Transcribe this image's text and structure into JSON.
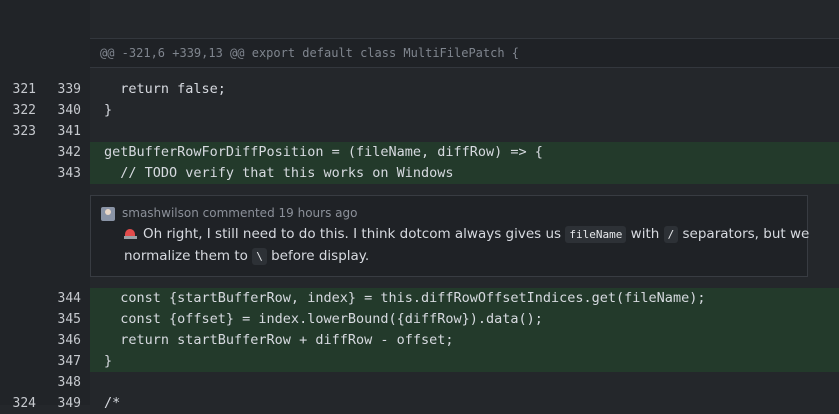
{
  "hunk_header": "@@ -321,6 +339,13 @@ export default class MultiFilePatch {",
  "lines_before": [
    {
      "old": "321",
      "new": "339",
      "code": "  return false;",
      "added": false
    },
    {
      "old": "322",
      "new": "340",
      "code": "}",
      "added": false
    },
    {
      "old": "323",
      "new": "341",
      "code": "",
      "added": false
    },
    {
      "old": "",
      "new": "342",
      "code": "getBufferRowForDiffPosition = (fileName, diffRow) => {",
      "added": true
    },
    {
      "old": "",
      "new": "343",
      "code": "  // TODO verify that this works on Windows",
      "added": true
    }
  ],
  "comment": {
    "author": "smashwilson",
    "action": "commented",
    "time": "19 hours ago",
    "emoji": "rotating-light-icon",
    "line1_a": "Oh right, I still need to do this. I think dotcom always gives us ",
    "code1": "fileName",
    "line1_b": " with ",
    "code2": "/",
    "line1_c": " separators, but we",
    "line2_a": "normalize them to ",
    "code3": "\\",
    "line2_b": " before display."
  },
  "lines_after": [
    {
      "old": "",
      "new": "344",
      "code": "  const {startBufferRow, index} = this.diffRowOffsetIndices.get(fileName);",
      "added": true
    },
    {
      "old": "",
      "new": "345",
      "code": "  const {offset} = index.lowerBound({diffRow}).data();",
      "added": true
    },
    {
      "old": "",
      "new": "346",
      "code": "  return startBufferRow + diffRow - offset;",
      "added": true
    },
    {
      "old": "",
      "new": "347",
      "code": "}",
      "added": true
    },
    {
      "old": "",
      "new": "348",
      "code": "",
      "added": true
    },
    {
      "old": "324",
      "new": "349",
      "code": "/*",
      "added": false
    }
  ]
}
